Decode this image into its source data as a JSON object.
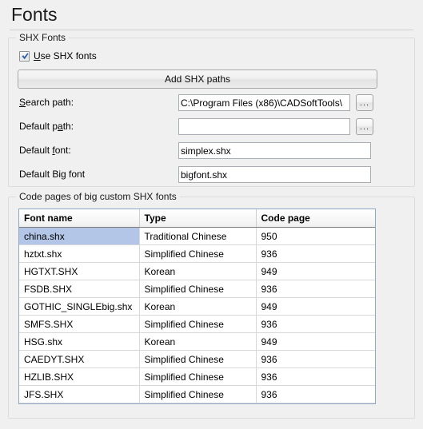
{
  "page": {
    "title": "Fonts"
  },
  "shx_group": {
    "title": "SHX Fonts",
    "use_shx": {
      "label_pre": "U",
      "label_accel": "U",
      "label_rest": "se SHX fonts",
      "label_full": "Use SHX fonts",
      "checked": true
    },
    "add_paths_button": "Add SHX paths",
    "fields": [
      {
        "label_before": "",
        "label_accel": "S",
        "label_after": "earch path:",
        "label_full": "Search path:",
        "value": "C:\\Program Files (x86)\\CADSoftTools\\",
        "placeholder": "",
        "has_browse": true,
        "browse_label": "..."
      },
      {
        "label_before": "Default p",
        "label_accel": "a",
        "label_after": "th:",
        "label_full": "Default path:",
        "value": "",
        "placeholder": "",
        "has_browse": true,
        "browse_label": "..."
      },
      {
        "label_before": "Default ",
        "label_accel": "f",
        "label_after": "ont:",
        "label_full": "Default font:",
        "value": "simplex.shx",
        "placeholder": "",
        "has_browse": false,
        "browse_label": ""
      },
      {
        "label_before": "Default Big font",
        "label_accel": "",
        "label_after": "",
        "label_full": "Default Big font",
        "value": "bigfont.shx",
        "placeholder": "",
        "has_browse": false,
        "browse_label": ""
      }
    ]
  },
  "codepages_group": {
    "title": "Code pages of big custom SHX fonts",
    "table": {
      "columns": [
        "Font name",
        "Type",
        "Code page"
      ],
      "selected_row_index": 0,
      "selection_color": "#b3c6e7",
      "rows": [
        [
          "china.shx",
          "Traditional Chinese",
          "950"
        ],
        [
          "hztxt.shx",
          "Simplified Chinese",
          "936"
        ],
        [
          "HGTXT.SHX",
          "Korean",
          "949"
        ],
        [
          "FSDB.SHX",
          "Simplified Chinese",
          "936"
        ],
        [
          "GOTHIC_SINGLEbig.shx",
          "Korean",
          "949"
        ],
        [
          "SMFS.SHX",
          "Simplified Chinese",
          "936"
        ],
        [
          "HSG.shx",
          "Korean",
          "949"
        ],
        [
          "CAEDYT.SHX",
          "Simplified Chinese",
          "936"
        ],
        [
          "HZLIB.SHX",
          "Simplified Chinese",
          "936"
        ],
        [
          "JFS.SHX",
          "Simplified Chinese",
          "936"
        ]
      ]
    }
  }
}
